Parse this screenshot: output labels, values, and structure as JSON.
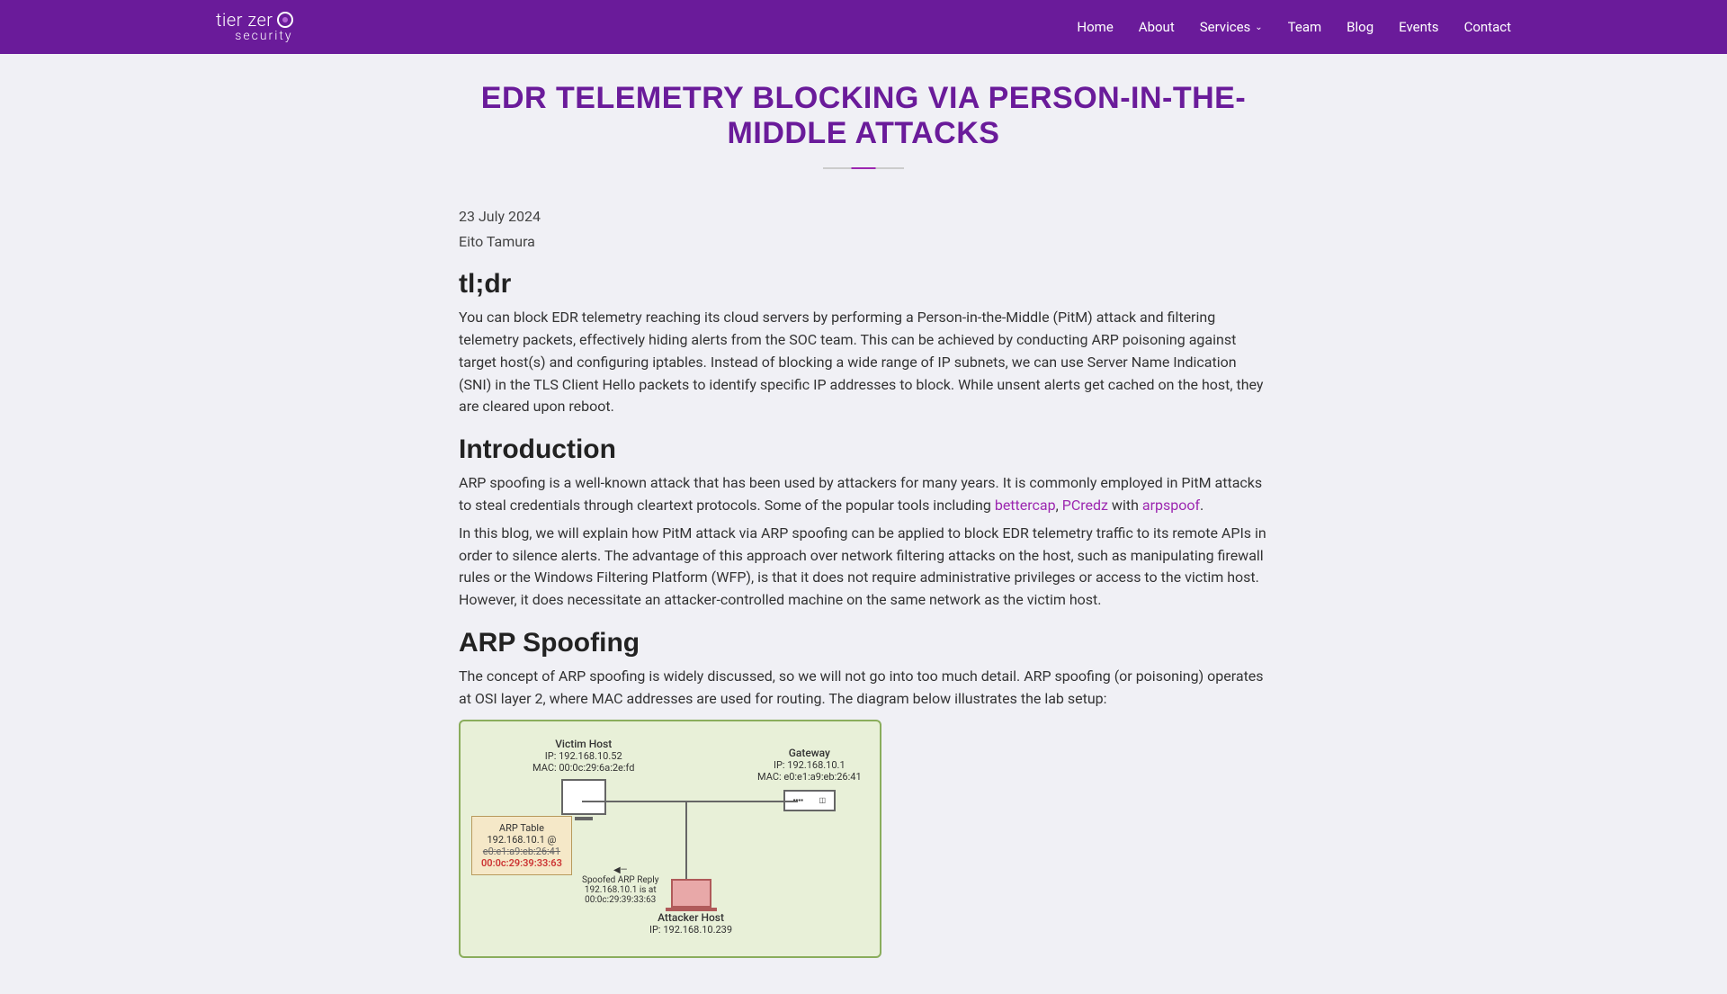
{
  "nav": {
    "logo_top1": "tier zer",
    "logo_bottom": "security",
    "items": [
      "Home",
      "About",
      "Services",
      "Team",
      "Blog",
      "Events",
      "Contact"
    ]
  },
  "page": {
    "title": "EDR TELEMETRY BLOCKING VIA PERSON-IN-THE-MIDDLE ATTACKS",
    "date": "23 July 2024",
    "author": "Eito Tamura"
  },
  "sections": {
    "tldr_heading": "tl;dr",
    "tldr_body": "You can block EDR telemetry reaching its cloud servers by performing a Person-in-the-Middle (PitM) attack and filtering telemetry packets, effectively hiding alerts from the SOC team. This can be achieved by conducting ARP poisoning against target host(s) and configuring iptables. Instead of blocking a wide range of IP subnets, we can use Server Name Indication (SNI) in the TLS Client Hello packets to identify specific IP addresses to block. While unsent alerts get cached on the host, they are cleared upon reboot.",
    "intro_heading": "Introduction",
    "intro_body1": "ARP spoofing is a well-known attack that has been used by attackers for many years. It is commonly employed in PitM attacks to steal credentials through cleartext protocols. Some of the popular tools including ",
    "intro_link1": "bettercap",
    "intro_sep1": ", ",
    "intro_link2": "PCredz",
    "intro_sep2": " with ",
    "intro_link3": "arpspoof",
    "intro_sep3": ".",
    "intro_body2": "In this blog, we will explain how PitM attack via ARP spoofing can be applied to block EDR telemetry traffic to its remote APIs in order to silence alerts. The advantage of this approach over network filtering attacks on the host, such as manipulating firewall rules or the Windows Filtering Platform (WFP), is that it does not require administrative privileges or access to the victim host. However, it does necessitate an attacker-controlled machine on the same network as the victim host.",
    "arp_heading": "ARP Spoofing",
    "arp_body": "The concept of ARP spoofing is widely discussed, so we will not go into too much detail. ARP spoofing (or poisoning) operates at OSI layer 2, where MAC addresses are used for routing. The diagram below illustrates the lab setup:"
  },
  "diagram": {
    "victim_label": "Victim Host",
    "victim_ip": "IP: 192.168.10.52",
    "victim_mac": "MAC: 00:0c:29:6a:2e:fd",
    "gateway_label": "Gateway",
    "gateway_ip": "IP: 192.168.10.1",
    "gateway_mac": "MAC: e0:e1:a9:eb:26:41",
    "arp_title": "ARP Table",
    "arp_line1": "192.168.10.1 @",
    "arp_line2": "e0:e1:a9:eb:26:41",
    "arp_line3": "00:0c:29:39:33:63",
    "arrow_label1": "Spoofed ARP Reply",
    "arrow_label2": "192.168.10.1 is at",
    "arrow_label3": "00:0c:29:39:33:63",
    "attacker_label": "Attacker Host",
    "attacker_ip": "IP: 192.168.10.239"
  }
}
